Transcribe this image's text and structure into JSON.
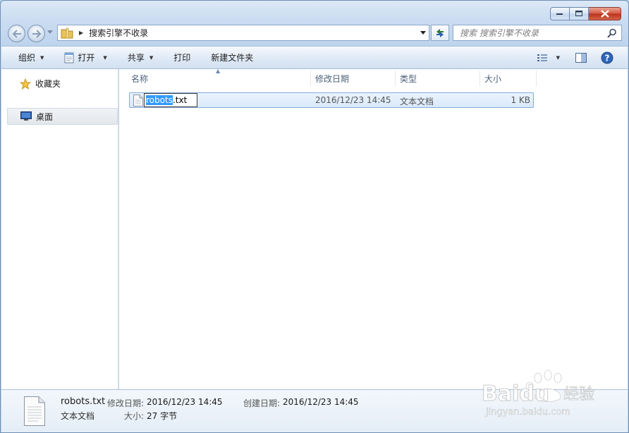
{
  "window": {
    "address_path": "搜索引擎不收录",
    "search_placeholder": "搜索 搜索引擎不收录"
  },
  "toolbar": {
    "organize": "组织",
    "open": "打开",
    "share": "共享",
    "print": "打印",
    "new_folder": "新建文件夹"
  },
  "navpane": {
    "favorites": "收藏夹",
    "desktop": "桌面"
  },
  "columns": {
    "name": "名称",
    "modified": "修改日期",
    "type": "类型",
    "size": "大小"
  },
  "file": {
    "name_selected": "robots",
    "name_rest": ".txt",
    "modified": "2016/12/23 14:45",
    "type": "文本文档",
    "size": "1 KB"
  },
  "details": {
    "filename": "robots.txt",
    "type": "文本文档",
    "modified_label": "修改日期:",
    "modified_value": "2016/12/23 14:45",
    "created_label": "创建日期:",
    "created_value": "2016/12/23 14:45",
    "size_label": "大小:",
    "size_value": "27 字节"
  },
  "watermark": {
    "brand": "Baidu",
    "suffix": "经验",
    "url": "jingyan.baidu.com"
  },
  "colors": {
    "accent": "#3399ff",
    "selection_border": "#84acdd",
    "close_button": "#c8412a"
  }
}
